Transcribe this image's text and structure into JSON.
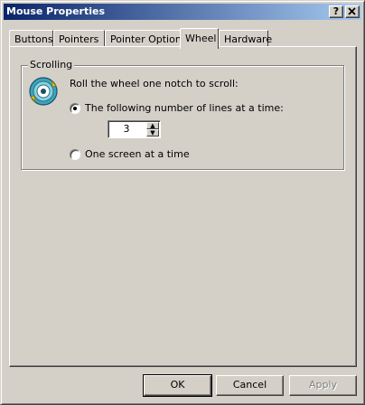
{
  "window": {
    "title": "Mouse Properties",
    "help_button": "?",
    "close_button": "X"
  },
  "tabs": [
    {
      "label": "Buttons",
      "active": false
    },
    {
      "label": "Pointers",
      "active": false
    },
    {
      "label": "Pointer Options",
      "active": false
    },
    {
      "label": "Wheel",
      "active": true
    },
    {
      "label": "Hardware",
      "active": false
    }
  ],
  "scrolling": {
    "group_title": "Scrolling",
    "icon": "mouse-wheel-icon",
    "lead_text": "Roll the wheel one notch to scroll:",
    "option_lines_label": "The following number of lines at a time:",
    "option_lines_selected": true,
    "lines_value": "3",
    "option_screen_label": "One screen at a time",
    "option_screen_selected": false
  },
  "buttons": {
    "ok": "OK",
    "cancel": "Cancel",
    "apply": "Apply"
  },
  "colors": {
    "title_start": "#0a246a",
    "title_end": "#a6caf0",
    "face": "#d4d0c8"
  }
}
